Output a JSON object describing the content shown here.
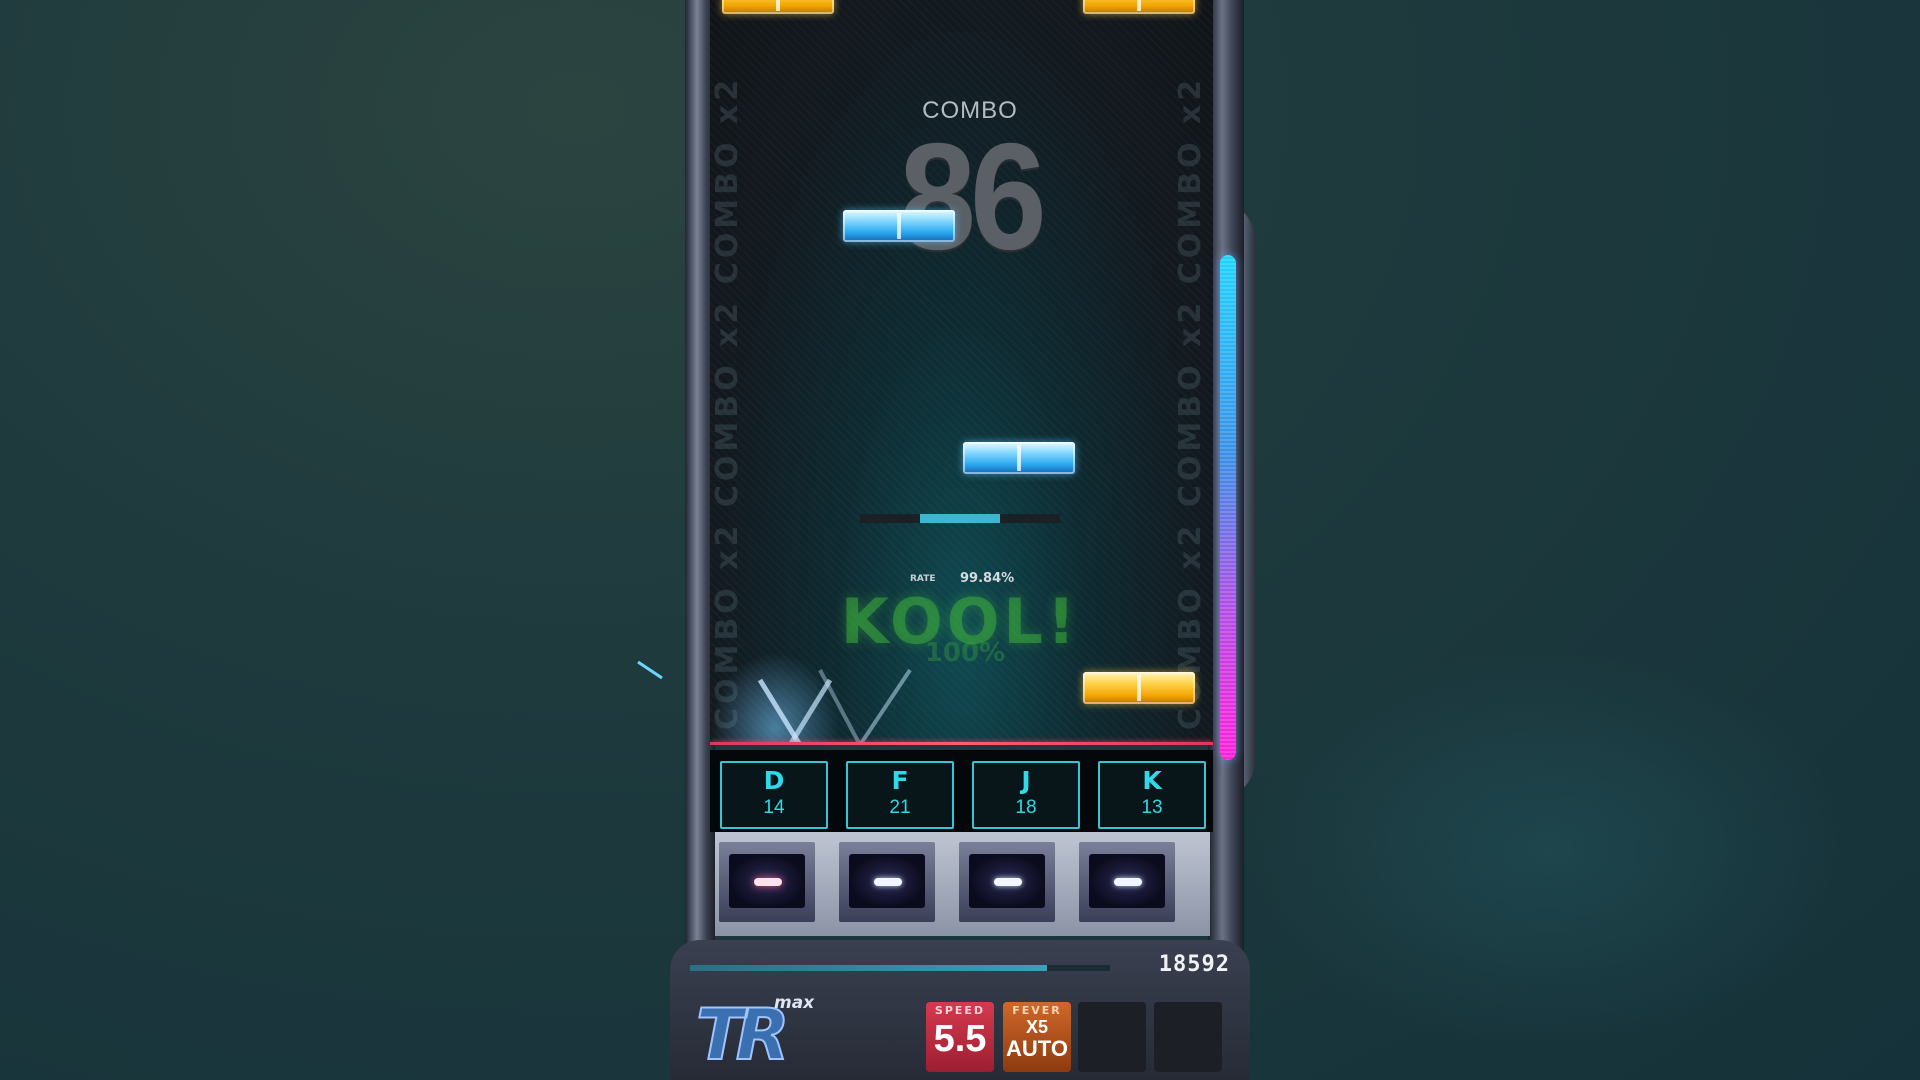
{
  "playfield": {
    "side_text": "COMBO x2 COMBO x2 COMBO x2",
    "combo_label": "COMBO",
    "combo_value": "86",
    "rate_label": "RATE",
    "rate_value": "99.84%",
    "judgement": "KOOL!",
    "judgement_sub": "100%"
  },
  "keys": [
    {
      "key": "D",
      "count": "14"
    },
    {
      "key": "F",
      "count": "21"
    },
    {
      "key": "J",
      "count": "18"
    },
    {
      "key": "K",
      "count": "13"
    }
  ],
  "bottom": {
    "score": "18592",
    "logo_main": "TR",
    "logo_sub": "max",
    "speed_label": "SPEED",
    "speed_value": "5.5",
    "fever_label": "FEVER",
    "fever_mult": "X5",
    "fever_mode": "AUTO",
    "song_progress": 0.85
  },
  "colors": {
    "key_accent": "#31d8e8",
    "hit_line": "#ff5d6a",
    "speed_panel": "#d53a4f",
    "fever_panel": "#d0682a"
  }
}
